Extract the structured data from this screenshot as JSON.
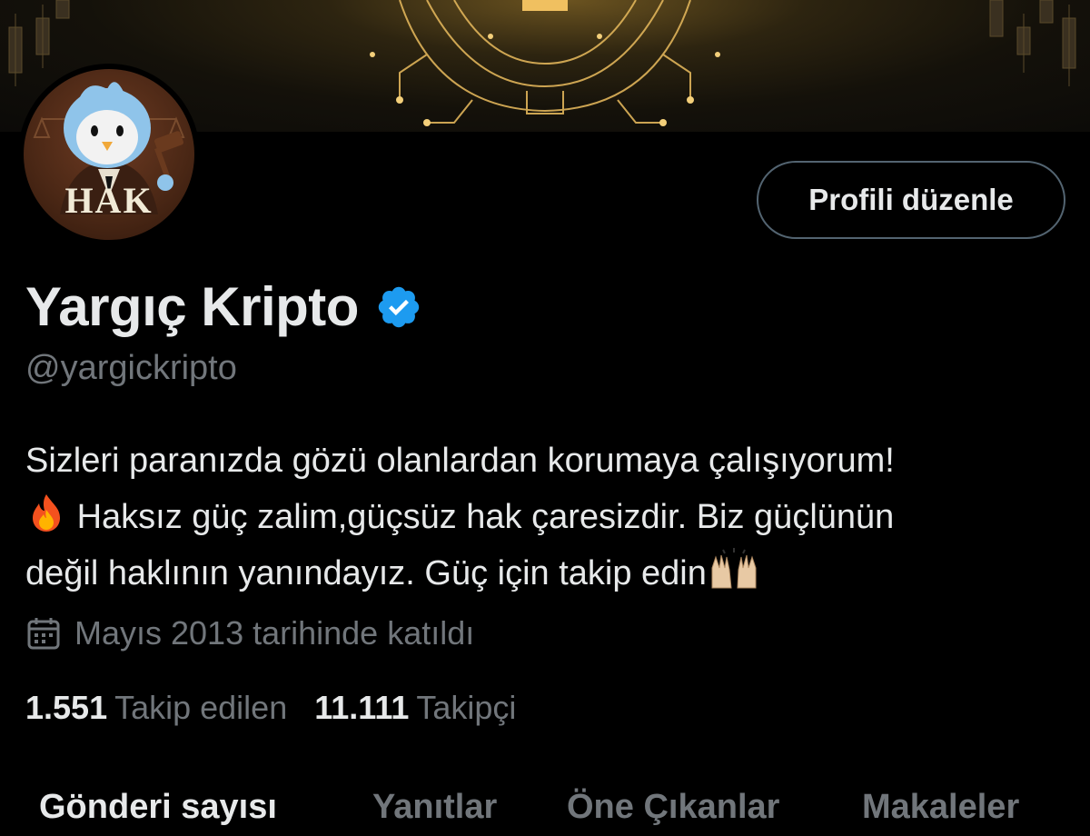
{
  "profile": {
    "display_name": "Yargıç Kripto",
    "verified": true,
    "handle": "@yargickripto",
    "avatar_text": "HAK",
    "edit_button_label": "Profili düzenle",
    "bio_lines": [
      "Sizleri paranızda gözü olanlardan korumaya çalışıyorum!",
      "Haksız güç zalim,güçsüz hak çaresizdir. Biz güçlünün",
      "değil haklının yanındayız. Güç için takip edin"
    ],
    "bio_emojis": [
      "fire-emoji",
      "raising-hands-emoji"
    ],
    "joined": "Mayıs 2013 tarihinde katıldı",
    "following_count": "1.551",
    "following_label": "Takip edilen",
    "followers_count": "11.111",
    "followers_label": "Takipçi"
  },
  "tabs": [
    {
      "label": "Gönderi sayısı",
      "active": true
    },
    {
      "label": "Yanıtlar",
      "active": false
    },
    {
      "label": "Öne Çıkanlar",
      "active": false
    },
    {
      "label": "Makaleler",
      "active": false
    }
  ],
  "colors": {
    "background": "#000000",
    "primary_text": "#e7e9ea",
    "secondary_text": "#71767b",
    "verified_blue": "#1d9bf0",
    "banner_gold": "#c9a24a"
  }
}
